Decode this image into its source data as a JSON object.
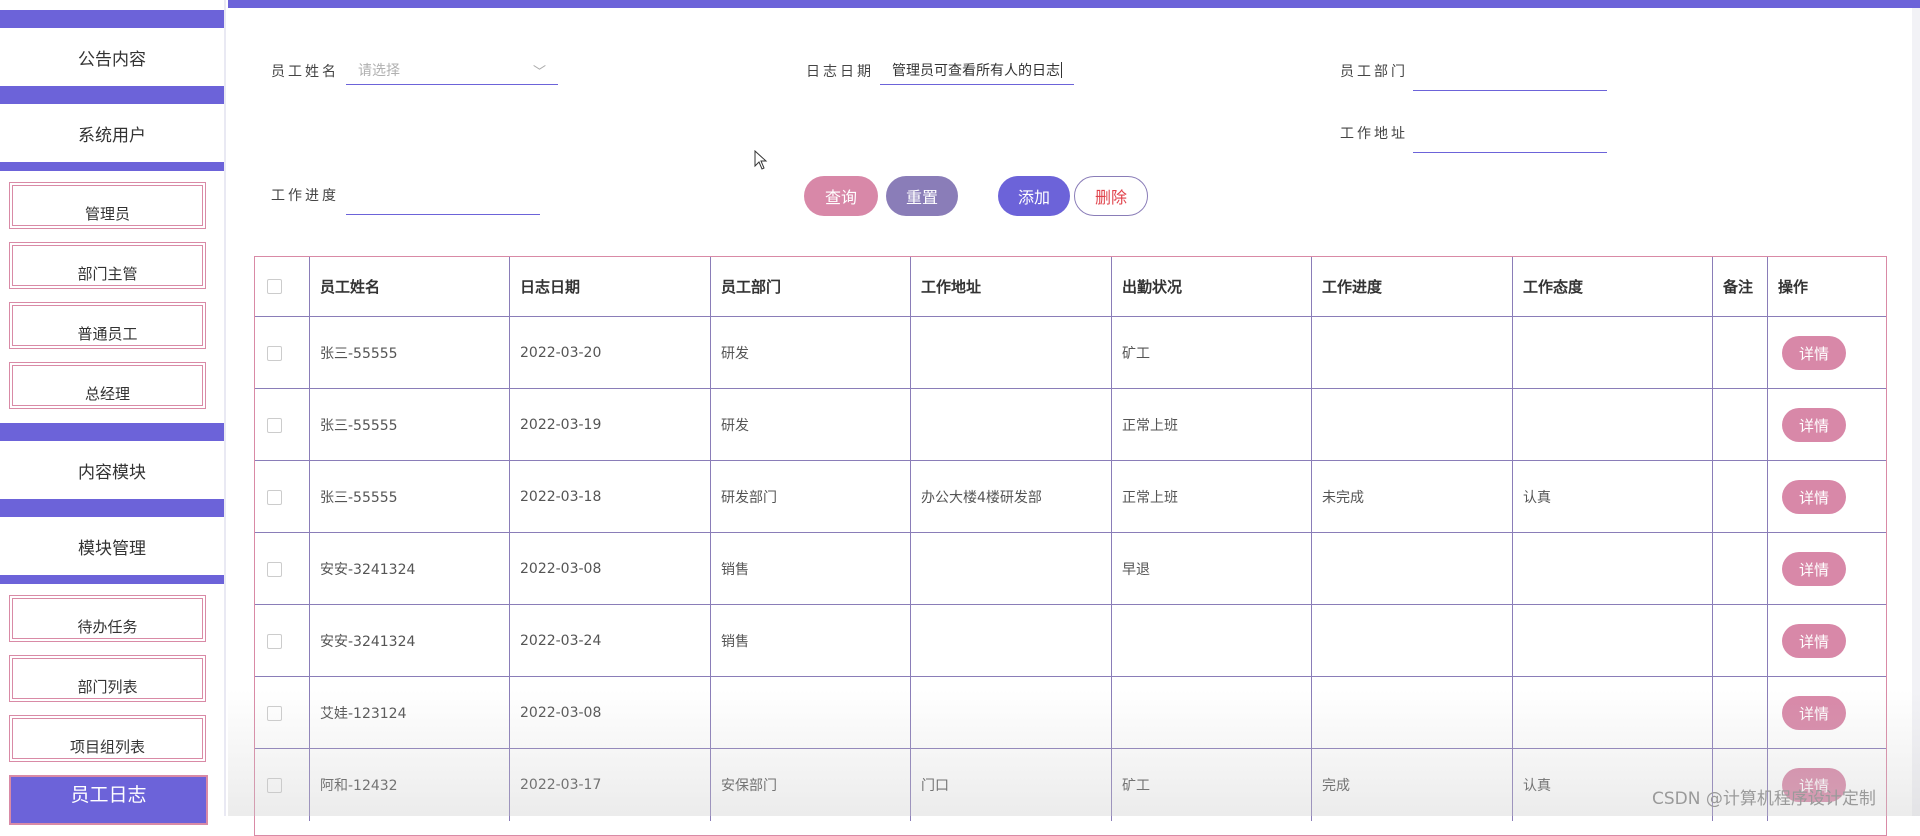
{
  "sidebar": {
    "sections": [
      {
        "label": "公告内容"
      },
      {
        "label": "系统用户"
      },
      {
        "label": "内容模块"
      },
      {
        "label": "模块管理"
      }
    ],
    "items": [
      {
        "label": "管理员"
      },
      {
        "label": "部门主管"
      },
      {
        "label": "普通员工"
      },
      {
        "label": "总经理"
      },
      {
        "label": "待办任务"
      },
      {
        "label": "部门列表"
      },
      {
        "label": "项目组列表"
      }
    ],
    "active": "员工日志"
  },
  "search": {
    "name_label": "员工姓名",
    "name_placeholder": "请选择",
    "date_label": "日志日期",
    "date_value": "管理员可查看所有人的日志",
    "dept_label": "员工部门",
    "dept_value": "",
    "addr_label": "工作地址",
    "addr_value": "",
    "progress_label": "工作进度",
    "progress_value": ""
  },
  "buttons": {
    "query": "查询",
    "reset": "重置",
    "add": "添加",
    "delete": "删除"
  },
  "table": {
    "headers": [
      "员工姓名",
      "日志日期",
      "员工部门",
      "工作地址",
      "出勤状况",
      "工作进度",
      "工作态度",
      "备注",
      "操作"
    ],
    "action_label": "详情",
    "rows": [
      {
        "name": "张三-55555",
        "date": "2022-03-20",
        "dept": "研发",
        "addr": "",
        "attendance": "矿工",
        "progress": "",
        "attitude": "",
        "note": ""
      },
      {
        "name": "张三-55555",
        "date": "2022-03-19",
        "dept": "研发",
        "addr": "",
        "attendance": "正常上班",
        "progress": "",
        "attitude": "",
        "note": ""
      },
      {
        "name": "张三-55555",
        "date": "2022-03-18",
        "dept": "研发部门",
        "addr": "办公大楼4楼研发部",
        "attendance": "正常上班",
        "progress": "未完成",
        "attitude": "认真",
        "note": ""
      },
      {
        "name": "安安-3241324",
        "date": "2022-03-08",
        "dept": "销售",
        "addr": "",
        "attendance": "早退",
        "progress": "",
        "attitude": "",
        "note": ""
      },
      {
        "name": "安安-3241324",
        "date": "2022-03-24",
        "dept": "销售",
        "addr": "",
        "attendance": "",
        "progress": "",
        "attitude": "",
        "note": ""
      },
      {
        "name": "艾娃-123124",
        "date": "2022-03-08",
        "dept": "",
        "addr": "",
        "attendance": "",
        "progress": "",
        "attitude": "",
        "note": ""
      },
      {
        "name": "阿和-12432",
        "date": "2022-03-17",
        "dept": "安保部门",
        "addr": "门口",
        "attendance": "矿工",
        "progress": "完成",
        "attitude": "认真",
        "note": ""
      }
    ]
  },
  "watermark": "CSDN @计算机程序设计定制",
  "colors": {
    "primary": "#6c63d9",
    "pink": "#d888a8",
    "mauve": "#8a7db8"
  }
}
